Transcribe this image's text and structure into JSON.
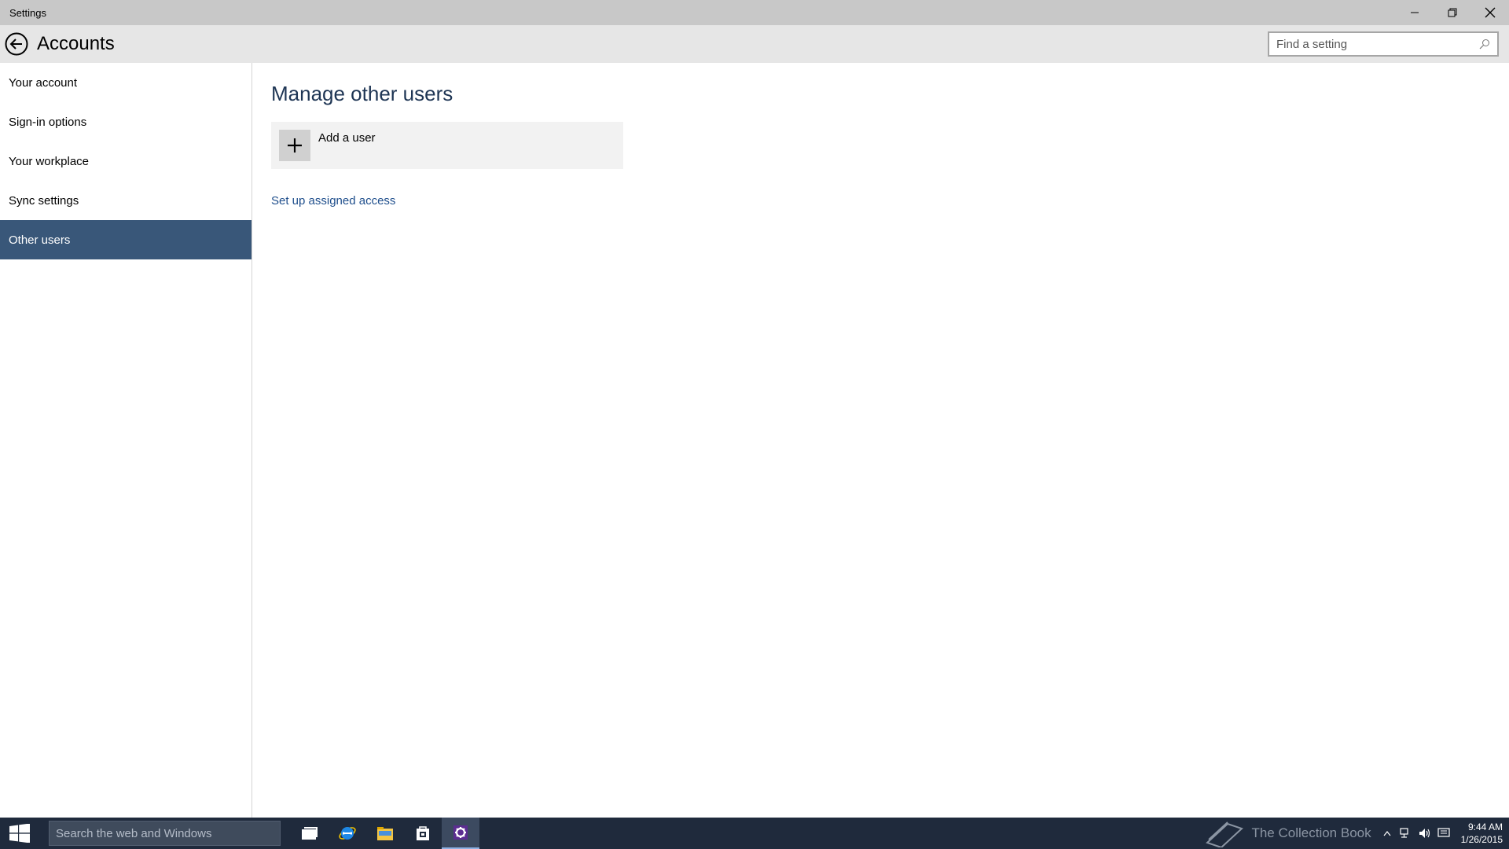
{
  "window": {
    "title": "Settings"
  },
  "header": {
    "title": "Accounts",
    "search_placeholder": "Find a setting"
  },
  "sidebar": {
    "items": [
      {
        "label": "Your account",
        "active": false
      },
      {
        "label": "Sign-in options",
        "active": false
      },
      {
        "label": "Your workplace",
        "active": false
      },
      {
        "label": "Sync settings",
        "active": false
      },
      {
        "label": "Other users",
        "active": true
      }
    ]
  },
  "main": {
    "section_title": "Manage other users",
    "add_user_label": "Add a user",
    "assigned_access_link": "Set up assigned access"
  },
  "taskbar": {
    "search_placeholder": "Search the web and Windows",
    "watermark": "The Collection Book",
    "time": "9:44 AM",
    "date": "1/26/2015"
  },
  "colors": {
    "accent": "#395779",
    "title_bar": "#c8c8c8",
    "header": "#e6e6e6",
    "taskbar": "#1f2a3c",
    "link": "#1e4e8c"
  }
}
